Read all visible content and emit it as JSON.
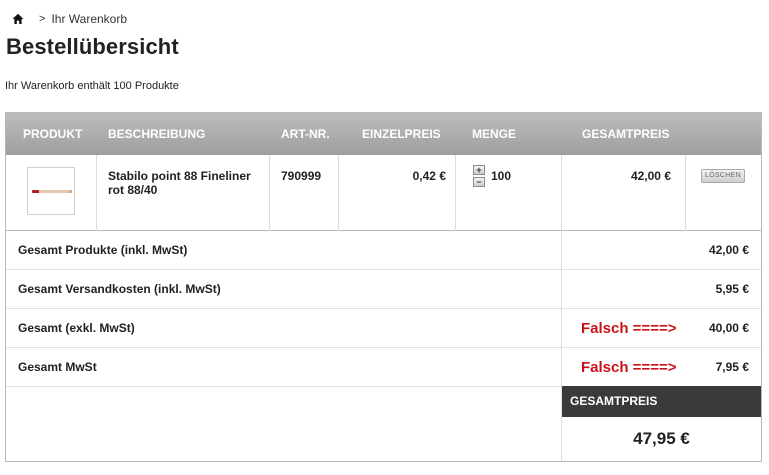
{
  "breadcrumb": {
    "home_icon": "home-icon",
    "separator": ">",
    "current": "Ihr Warenkorb"
  },
  "page_title": "Bestellübersicht",
  "cart_count_text": "Ihr Warenkorb enthält 100 Produkte",
  "table": {
    "headers": [
      "PRODUKT",
      "BESCHREIBUNG",
      "ART-NR.",
      "EINZELPREIS",
      "MENGE",
      "GESAMTPREIS"
    ],
    "items": [
      {
        "image_icon": "fineliner-product-image",
        "description": "Stabilo point 88 Fineliner rot 88/40",
        "art_nr": "790999",
        "unit_price": "0,42 €",
        "quantity": "100",
        "plus": "+",
        "minus": "−",
        "total": "42,00 €",
        "delete_label": "LÖSCHEN"
      }
    ]
  },
  "summary": [
    {
      "label": "Gesamt Produkte (inkl. MwSt)",
      "value": "42,00 €",
      "note": ""
    },
    {
      "label": "Gesamt Versandkosten (inkl. MwSt)",
      "value": "5,95 €",
      "note": ""
    },
    {
      "label": "Gesamt (exkl. MwSt)",
      "value": "40,00 €",
      "note": "Falsch ====>"
    },
    {
      "label": "Gesamt MwSt",
      "value": "7,95 €",
      "note": "Falsch ====>"
    }
  ],
  "grand_total": {
    "label": "GESAMTPREIS",
    "value": "47,95 €"
  },
  "colors": {
    "header_gradient_top": "#bdbdbd",
    "header_gradient_bottom": "#9e9e9e",
    "grand_header_bg": "#3a3a3a",
    "annotation_red": "#c8121a"
  }
}
